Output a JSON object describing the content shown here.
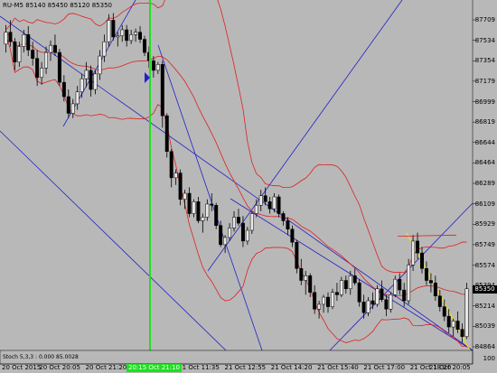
{
  "header": {
    "symbol": "RU-M5",
    "ohlc": "85140 85450 85120 85350"
  },
  "subwindow": {
    "label": "Stoch 5,3,3 : 0.000 85.0028",
    "axis_value": "100"
  },
  "current_price": "85350",
  "price_axis": {
    "labels": [
      "87709",
      "87534",
      "87354",
      "87179",
      "86999",
      "86819",
      "86644",
      "86464",
      "86289",
      "86109",
      "85929",
      "85749",
      "85574",
      "85394",
      "85214",
      "85039",
      "84864"
    ]
  },
  "time_axis": {
    "labels": [
      "20 Oct 2015",
      "20 Oct 20:05",
      "20 Oct 21:20",
      "21 Oct 10:15",
      "21 Oct 11:35",
      "21 Oct 12:55",
      "21 Oct 14:20",
      "21 Oct 15:40",
      "21 Oct 17:00",
      "21 Oct 18:20",
      "21 Oct 20:05"
    ],
    "cursor_label": "20:15 Oct 21:10"
  },
  "chart_data": {
    "type": "candlestick",
    "symbol": "RU-M5",
    "price_range": [
      84864,
      87709
    ],
    "colors": {
      "bull": "#e8e8e8",
      "bear": "#000000",
      "wick": "#000000",
      "bands": "#e02020",
      "trendlines": "#2020c8",
      "cursor": "#1ee01e",
      "yellow_line": "#e8e020"
    },
    "candles": [
      [
        87400,
        87560,
        87330,
        87500
      ],
      [
        87500,
        87600,
        87380,
        87420
      ],
      [
        87420,
        87450,
        87180,
        87250
      ],
      [
        87250,
        87420,
        87210,
        87380
      ],
      [
        87380,
        87520,
        87330,
        87480
      ],
      [
        87480,
        87550,
        87300,
        87350
      ],
      [
        87350,
        87420,
        87220,
        87280
      ],
      [
        87280,
        87350,
        87050,
        87120
      ],
      [
        87120,
        87250,
        87060,
        87200
      ],
      [
        87200,
        87380,
        87150,
        87330
      ],
      [
        87330,
        87430,
        87260,
        87390
      ],
      [
        87390,
        87480,
        87300,
        87330
      ],
      [
        87330,
        87360,
        87050,
        87080
      ],
      [
        87080,
        87140,
        86920,
        86960
      ],
      [
        86960,
        87020,
        86780,
        86820
      ],
      [
        86820,
        86940,
        86780,
        86900
      ],
      [
        86900,
        87050,
        86850,
        87000
      ],
      [
        87000,
        87150,
        86950,
        87110
      ],
      [
        87110,
        87250,
        87040,
        87180
      ],
      [
        87180,
        87220,
        86960,
        87020
      ],
      [
        87020,
        87180,
        86980,
        87150
      ],
      [
        87150,
        87350,
        87100,
        87300
      ],
      [
        87300,
        87480,
        87250,
        87420
      ],
      [
        87420,
        87650,
        87380,
        87600
      ],
      [
        87600,
        87660,
        87430,
        87460
      ],
      [
        87460,
        87500,
        87380,
        87470
      ],
      [
        87470,
        87560,
        87420,
        87520
      ],
      [
        87520,
        87560,
        87380,
        87430
      ],
      [
        87430,
        87520,
        87400,
        87480
      ],
      [
        87480,
        87530,
        87420,
        87500
      ],
      [
        87500,
        87550,
        87410,
        87440
      ],
      [
        87440,
        87470,
        87300,
        87330
      ],
      [
        87330,
        87380,
        87200,
        87260
      ],
      [
        87260,
        87300,
        87120,
        87180
      ],
      [
        87180,
        87250,
        87150,
        87230
      ],
      [
        87230,
        87260,
        86700,
        86800
      ],
      [
        86800,
        86820,
        86450,
        86500
      ],
      [
        86500,
        86520,
        86200,
        86280
      ],
      [
        86280,
        86350,
        86220,
        86320
      ],
      [
        86320,
        86350,
        86050,
        86100
      ],
      [
        86100,
        86180,
        86020,
        86150
      ],
      [
        86150,
        86200,
        85950,
        85980
      ],
      [
        85980,
        86100,
        85950,
        86080
      ],
      [
        86080,
        86120,
        85900,
        85920
      ],
      [
        85920,
        85980,
        85820,
        85950
      ],
      [
        85950,
        86100,
        85920,
        86060
      ],
      [
        86060,
        86150,
        86000,
        86050
      ],
      [
        86050,
        86070,
        85850,
        85880
      ],
      [
        85880,
        85920,
        85700,
        85720
      ],
      [
        85720,
        85800,
        85650,
        85780
      ],
      [
        85780,
        85900,
        85750,
        85860
      ],
      [
        85860,
        86000,
        85830,
        85950
      ],
      [
        85950,
        86020,
        85880,
        85900
      ],
      [
        85900,
        85960,
        85700,
        85750
      ],
      [
        85750,
        85870,
        85720,
        85840
      ],
      [
        85840,
        86000,
        85810,
        85980
      ],
      [
        85980,
        86100,
        85950,
        86050
      ],
      [
        86050,
        86180,
        86000,
        86130
      ],
      [
        86130,
        86200,
        86050,
        86080
      ],
      [
        86080,
        86120,
        85980,
        86020
      ],
      [
        86020,
        86150,
        85990,
        86120
      ],
      [
        86120,
        86140,
        85950,
        85980
      ],
      [
        85980,
        86000,
        85880,
        85920
      ],
      [
        85920,
        85950,
        85800,
        85850
      ],
      [
        85850,
        85880,
        85700,
        85740
      ],
      [
        85740,
        85760,
        85480,
        85520
      ],
      [
        85520,
        85600,
        85380,
        85420
      ],
      [
        85420,
        85500,
        85300,
        85460
      ],
      [
        85460,
        85480,
        85280,
        85320
      ],
      [
        85320,
        85380,
        85140,
        85180
      ],
      [
        85180,
        85250,
        85100,
        85220
      ],
      [
        85220,
        85300,
        85150,
        85280
      ],
      [
        85280,
        85320,
        85150,
        85200
      ],
      [
        85200,
        85350,
        85180,
        85320
      ],
      [
        85320,
        85400,
        85250,
        85300
      ],
      [
        85300,
        85450,
        85280,
        85420
      ],
      [
        85420,
        85460,
        85310,
        85350
      ],
      [
        85350,
        85500,
        85300,
        85460
      ],
      [
        85460,
        85520,
        85380,
        85400
      ],
      [
        85400,
        85430,
        85200,
        85240
      ],
      [
        85240,
        85300,
        85100,
        85150
      ],
      [
        85150,
        85280,
        85120,
        85250
      ],
      [
        85250,
        85320,
        85180,
        85220
      ],
      [
        85220,
        85380,
        85200,
        85350
      ],
      [
        85350,
        85420,
        85240,
        85260
      ],
      [
        85260,
        85300,
        85120,
        85180
      ],
      [
        85180,
        85320,
        85150,
        85300
      ],
      [
        85300,
        85460,
        85280,
        85430
      ],
      [
        85430,
        85480,
        85300,
        85340
      ],
      [
        85340,
        85400,
        85200,
        85250
      ],
      [
        85250,
        85600,
        85220,
        85550
      ],
      [
        85550,
        85800,
        85500,
        85750
      ],
      [
        85750,
        85820,
        85600,
        85650
      ],
      [
        85650,
        85700,
        85480,
        85520
      ],
      [
        85520,
        85580,
        85380,
        85420
      ],
      [
        85420,
        85480,
        85320,
        85400
      ],
      [
        85400,
        85460,
        85250,
        85290
      ],
      [
        85290,
        85340,
        85160,
        85200
      ],
      [
        85200,
        85260,
        85080,
        85120
      ],
      [
        85120,
        85180,
        84980,
        85030
      ],
      [
        85030,
        85100,
        84950,
        85080
      ],
      [
        85080,
        85160,
        84980,
        85010
      ],
      [
        85010,
        85060,
        84900,
        84950
      ],
      [
        84950,
        85400,
        84930,
        85350
      ]
    ]
  }
}
